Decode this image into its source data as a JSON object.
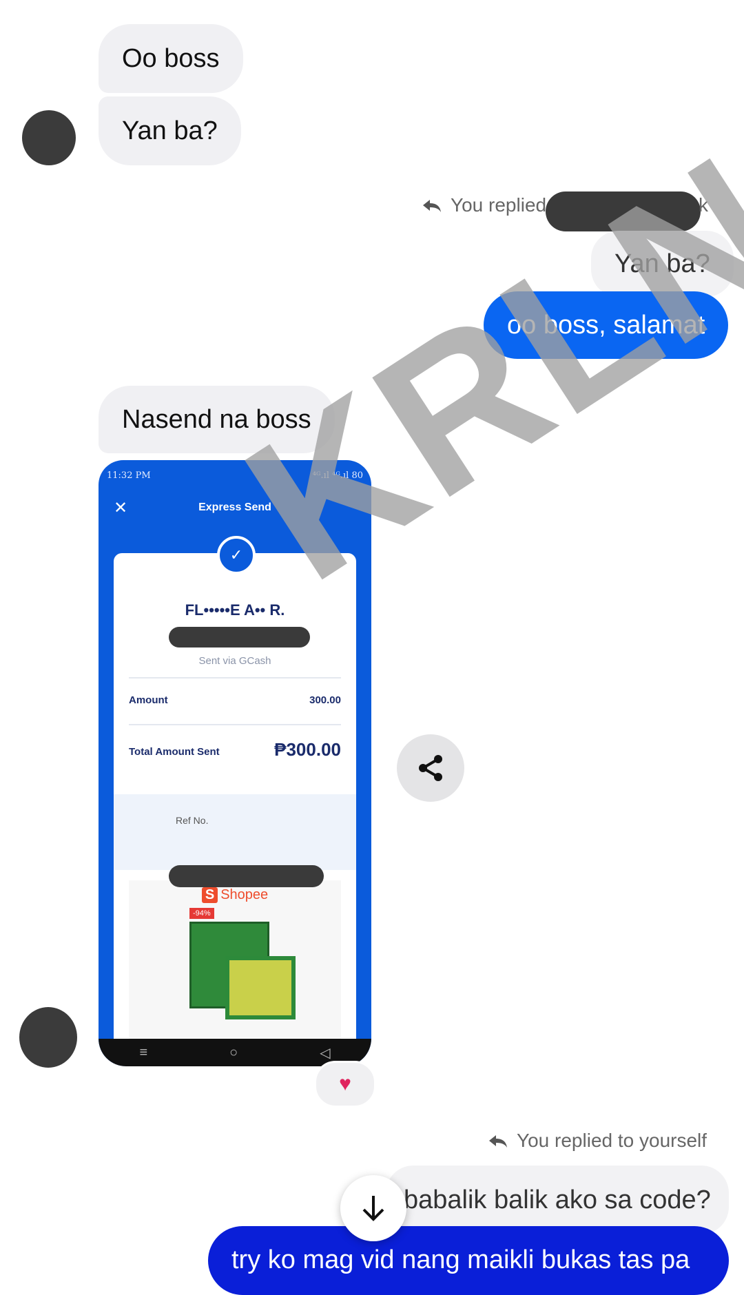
{
  "messages": {
    "m1": "Oo boss",
    "m2": "Yan ba?",
    "reply1_label": "You replied t",
    "reply1_tail": "k",
    "reply1_quote": "Yan ba?",
    "m3": "oo boss, salamat",
    "m4": "Nasend na boss",
    "reply2_label": "You replied to yourself",
    "reply2_quote": "babalik balik ako sa code?",
    "m5": "try ko mag vid nang maikli bukas tas pa"
  },
  "receipt": {
    "status_time": "11:32 PM",
    "status_right": "⁴ᴳ.ıl ⁴ᴳ.ıl 80",
    "title": "Express Send",
    "recipient": "FL•••••E A•• R.",
    "via": "Sent via GCash",
    "amount_label": "Amount",
    "amount_value": "300.00",
    "total_label": "Total Amount Sent",
    "total_value": "₱300.00",
    "ref_label": "Ref No.",
    "ad_brand": "Shopee",
    "ad_discount": "-94%"
  },
  "watermark": "KRLN",
  "reaction": "♥",
  "colors": {
    "outgoing": "#0a66f2",
    "incoming": "#f0f0f3",
    "gcash_blue": "#0b5bdb"
  },
  "icons": {
    "reply": "reply-arrow-icon",
    "share": "share-icon",
    "scroll": "arrow-down-icon"
  }
}
